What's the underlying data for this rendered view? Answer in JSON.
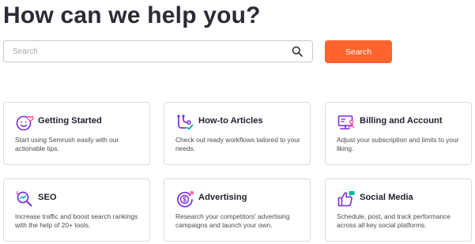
{
  "page": {
    "title": "How can we help you?"
  },
  "search": {
    "placeholder": "Search",
    "value": "",
    "button_label": "Search"
  },
  "colors": {
    "accent": "#ff642d",
    "icon_purple": "#7a2ce0",
    "icon_pink": "#ff4fa0",
    "icon_teal": "#00b89c"
  },
  "cards": [
    {
      "title": "Getting Started",
      "description": "Start using Semrush easily with our actionable tips.",
      "icon": "smile-heart-icon"
    },
    {
      "title": "How-to Articles",
      "description": "Check out ready workflows tailored to your needs.",
      "icon": "workflow-icon"
    },
    {
      "title": "Billing and Account",
      "description": "Adjust your subscription and limits to your liking.",
      "icon": "billing-account-icon"
    },
    {
      "title": "SEO",
      "description": "Increase traffic and boost search rankings with the help of 20+ tools.",
      "icon": "seo-magnifier-icon"
    },
    {
      "title": "Advertising",
      "description": "Research your competitors' advertising campaigns and launch your own.",
      "icon": "dollar-target-icon"
    },
    {
      "title": "Social Media",
      "description": "Schedule, post, and track performance across all key social platforms.",
      "icon": "thumbs-up-icon"
    }
  ]
}
